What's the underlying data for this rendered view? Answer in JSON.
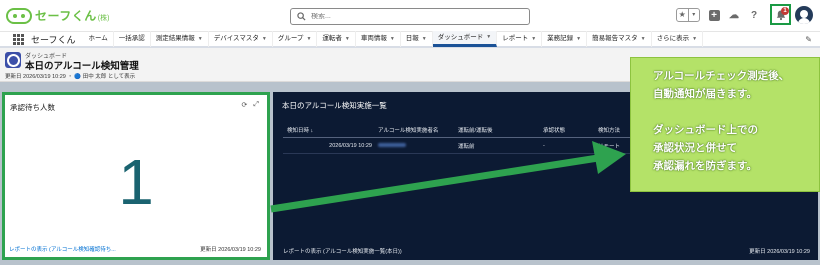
{
  "header": {
    "logo_text": "セーフくん",
    "logo_sub": "(株)",
    "search_placeholder": "検索...",
    "notification_count": "1"
  },
  "nav": {
    "app_name": "セーフくん",
    "items": [
      {
        "label": "ホーム",
        "caret": false
      },
      {
        "label": "一括承認",
        "caret": false
      },
      {
        "label": "測定結果情報",
        "caret": true
      },
      {
        "label": "デバイスマスタ",
        "caret": true
      },
      {
        "label": "グループ",
        "caret": true
      },
      {
        "label": "運転者",
        "caret": true
      },
      {
        "label": "車両情報",
        "caret": true
      },
      {
        "label": "日報",
        "caret": true
      },
      {
        "label": "ダッシュボード",
        "caret": true
      },
      {
        "label": "レポート",
        "caret": true
      },
      {
        "label": "業務記録",
        "caret": true
      },
      {
        "label": "簡易報告マスタ",
        "caret": true
      },
      {
        "label": "さらに表示",
        "caret": true
      }
    ],
    "active_index": 8
  },
  "page_header": {
    "object_label": "ダッシュボード",
    "title": "本日のアルコール検知管理",
    "meta": "更新日 2026/03/19 10:29 ・ 🔵 田中 太郎 として表示"
  },
  "left_card": {
    "title": "承認待ち人数",
    "value": "1",
    "link": "レポートの表示 (アルコール検知確認待ち...",
    "updated": "更新日 2026/03/19 10:29"
  },
  "right_card": {
    "title": "本日のアルコール検知実施一覧",
    "columns": [
      "検知日時 ↓",
      "アルコール検知実施者名",
      "運転前/運転後",
      "承認状態",
      "検知方法"
    ],
    "rows": [
      {
        "datetime": "2026/03/19 10:29",
        "name": "",
        "timing": "運転前",
        "status": "-",
        "method": "リモート"
      }
    ],
    "footer": "レポートの表示 (アルコール検知実施一覧(本日))",
    "updated": "更新日 2026/03/19 10:29"
  },
  "callout": {
    "lines": [
      "アルコールチェック測定後、",
      "自動通知が届きます。",
      "ダッシュボード上での",
      "承認状況と併せて",
      "承認漏れを防ぎます。"
    ]
  },
  "colors": {
    "highlight_green": "#2ea24f",
    "callout_bg": "#b4e268",
    "dark_panel": "#0c1a33",
    "big_number": "#1a6370"
  }
}
